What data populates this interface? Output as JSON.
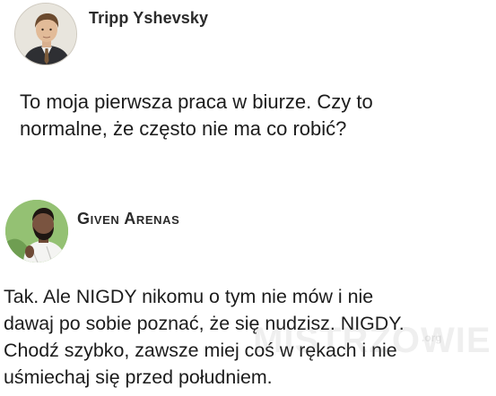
{
  "posts": [
    {
      "author": "Tripp Yshevsky",
      "avatar_icon": "profile-photo-man-in-suit",
      "text": "To moja pierwsza praca w biurze. Czy to\nnormalne, że często nie ma co robić?"
    },
    {
      "author": "Given Arenas",
      "avatar_icon": "profile-photo-man-with-beard",
      "text": "Tak. Ale NIGDY nikomu o tym nie mów i nie\ndawaj po sobie poznać, że się nudzisz. NIGDY.\nChodź szybko, zawsze miej coś w rękach i nie\nuśmiechaj się przed południem."
    }
  ],
  "watermark": {
    "text": "MISTRZOWIE",
    "suffix": ".org"
  }
}
